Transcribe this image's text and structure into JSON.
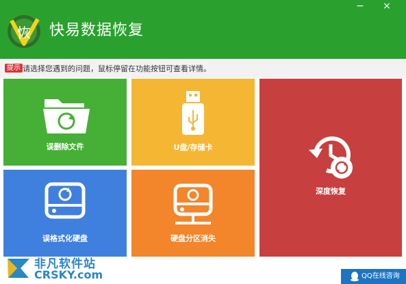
{
  "app": {
    "title": "快易数据恢复",
    "logo_glyph": "恢",
    "controls": {
      "minimize": "−",
      "close": "×"
    }
  },
  "tip": {
    "badge": "提示",
    "text": "请选择您遇到的问题，鼠标停留在功能按钮可查看详情。"
  },
  "tiles": [
    {
      "label": "误删除文件",
      "color": "#45b035",
      "icon": "folder-restore-icon"
    },
    {
      "label": "U盘/存储卡",
      "color": "#f5b733",
      "icon": "usb-drive-icon"
    },
    {
      "label": "深度恢复",
      "color": "#c7403f",
      "icon": "history-restore-icon"
    },
    {
      "label": "误格式化硬盘",
      "color": "#3f80de",
      "icon": "disk-restore-icon"
    },
    {
      "label": "硬盘分区消失",
      "color": "#f3852a",
      "icon": "network-disk-icon"
    }
  ],
  "footer": {
    "watermark_cn": "非凡软件站",
    "watermark_en": "CRSKY.com",
    "qq_label": "QQ在线咨询"
  },
  "colors": {
    "header": "#2aa12e",
    "accent": "#1e74c2"
  }
}
